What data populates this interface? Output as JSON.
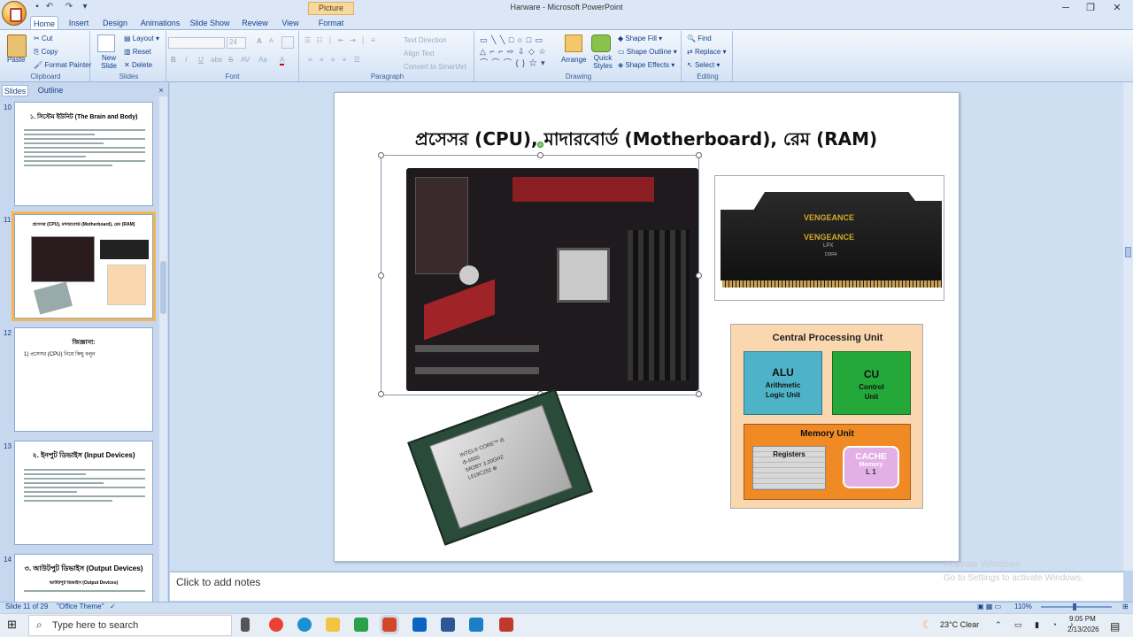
{
  "window": {
    "picture_tools": "Picture Tools",
    "title": "Harware - Microsoft PowerPoint",
    "minimize": "─",
    "maximize": "❐",
    "close": "✕"
  },
  "tabs": [
    "Home",
    "Insert",
    "Design",
    "Animations",
    "Slide Show",
    "Review",
    "View",
    "Format"
  ],
  "ribbon": {
    "clipboard": {
      "label": "Clipboard",
      "paste": "Paste",
      "cut": "Cut",
      "copy": "Copy",
      "format_painter": "Format Painter"
    },
    "slides": {
      "label": "Slides",
      "new_slide": "New Slide",
      "layout": "Layout",
      "reset": "Reset",
      "delete": "Delete"
    },
    "font": {
      "label": "Font",
      "size": "24",
      "bold": "B",
      "italic": "I",
      "underline": "U",
      "shadow": "abe",
      "strike": "S",
      "spacing": "AV",
      "case": "Aa",
      "color": "A",
      "grow": "A",
      "shrink": "A"
    },
    "paragraph": {
      "label": "Paragraph",
      "text_direction": "Text Direction",
      "align_text": "Align Text",
      "smartart": "Convert to SmartArt"
    },
    "drawing": {
      "label": "Drawing",
      "arrange": "Arrange",
      "quick_styles": "Quick Styles",
      "shape_fill": "Shape Fill",
      "shape_outline": "Shape Outline",
      "shape_effects": "Shape Effects"
    },
    "editing": {
      "label": "Editing",
      "find": "Find",
      "replace": "Replace",
      "select": "Select"
    }
  },
  "pane": {
    "tab_slides": "Slides",
    "tab_outline": "Outline",
    "close": "×",
    "thumbs": [
      {
        "num": "10",
        "title": "১. সিস্টেম ইউনিট (The Brain and Body)"
      },
      {
        "num": "11",
        "title": "প্রসেসর (CPU), মাদারবোর্ড (Motherboard), রেম (RAM)"
      },
      {
        "num": "12",
        "title": "জিজ্ঞাসা:",
        "line": "1) প্রসেসর (CPU) নিয়ে কিছু বলুন"
      },
      {
        "num": "13",
        "title": "২. ইনপুট ডিভাইস (Input Devices)"
      },
      {
        "num": "14",
        "title": "৩. আউটপুট ডিভাইস (Output Devices)",
        "sub": "আউটপুট ডিভাইস (Output Devices)"
      }
    ]
  },
  "slide": {
    "title": "প্রসেসর (CPU), মাদারবোর্ড (Motherboard), রেম (RAM)",
    "ram_label1": "VENGEANCE",
    "ram_label2": "VENGEANCE",
    "ram_label3": "LPX",
    "ram_label4": "DDR4",
    "cpu_chip": "INTEL® CORE™ i5\ni5-6500\nSR2BY 3.20GHZ\nL519C252 ⊕",
    "cpu_diagram": {
      "title": "Central Processing Unit",
      "alu": "ALU",
      "alu_sub": "Arithmetic Logic Unit",
      "cu": "CU",
      "cu_sub": "Control Unit",
      "memory": "Memory Unit",
      "registers": "Registers",
      "cache": "CACHE",
      "cache_sub": "Memory",
      "cache_l1": "L 1"
    }
  },
  "notes": "Click to add notes",
  "activate": {
    "line1": "Activate Windows",
    "line2": "Go to Settings to activate Windows."
  },
  "status": {
    "slide": "Slide 11 of 29",
    "theme": "\"Office Theme\"",
    "zoom": "110%"
  },
  "taskbar": {
    "search": "Type here to search",
    "weather": "23°C  Clear",
    "time": "9:05 PM",
    "date": "2/13/2026"
  },
  "colors": {
    "ribbon_bg": "#dbe7f6",
    "accent": "#f5b651",
    "alu": "#4fb3c8",
    "cu": "#25a83a",
    "memory": "#f08a24",
    "cpu_bg": "#fbd7b0"
  }
}
